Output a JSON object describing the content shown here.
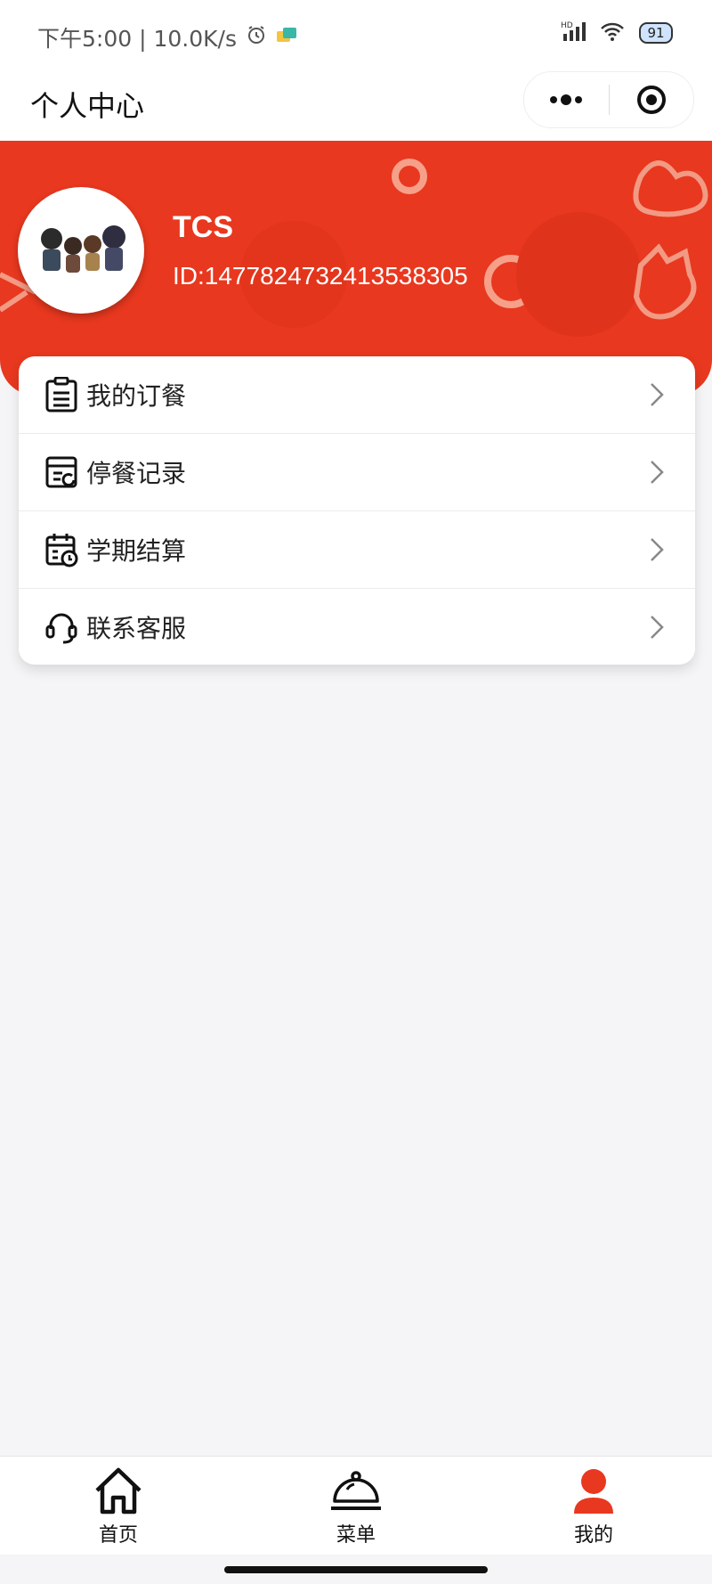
{
  "status_bar": {
    "time_speed": "下午5:00 | 10.0K/s",
    "battery": "91"
  },
  "navbar": {
    "title": "个人中心"
  },
  "profile": {
    "username": "TCS",
    "user_id": "ID:1477824732413538305"
  },
  "menu": [
    {
      "label": "我的订餐",
      "icon": "clipboard-list-icon"
    },
    {
      "label": "停餐记录",
      "icon": "record-card-icon"
    },
    {
      "label": "学期结算",
      "icon": "calendar-clock-icon"
    },
    {
      "label": "联系客服",
      "icon": "headset-icon"
    }
  ],
  "tabbar": [
    {
      "label": "首页",
      "icon": "home-icon",
      "active": false
    },
    {
      "label": "菜单",
      "icon": "cloche-icon",
      "active": false
    },
    {
      "label": "我的",
      "icon": "user-icon",
      "active": true
    }
  ],
  "colors": {
    "accent": "#e8381f",
    "background": "#f5f5f7"
  }
}
